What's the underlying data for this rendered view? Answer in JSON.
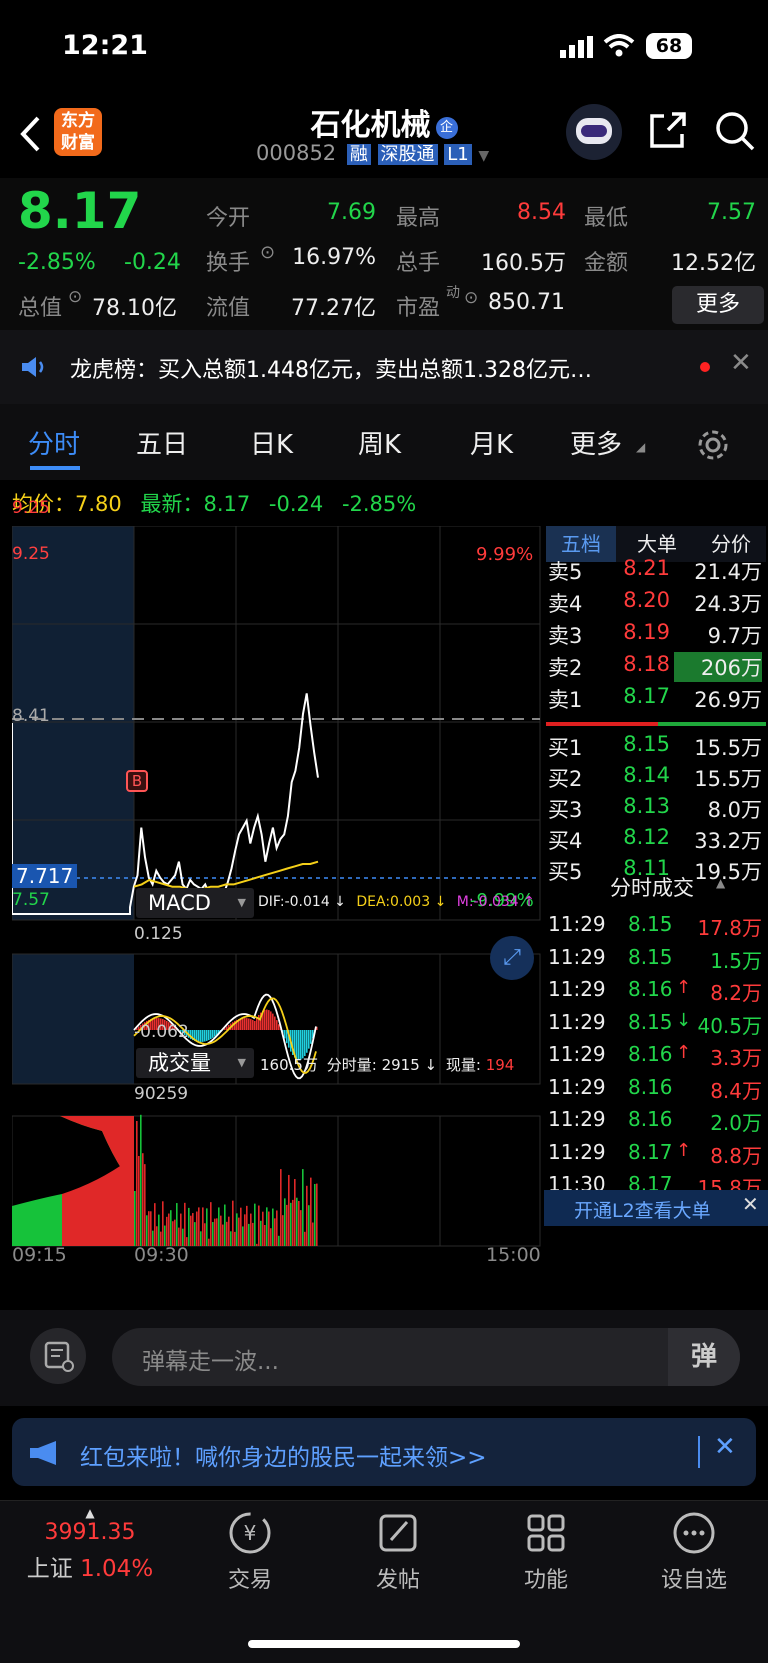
{
  "status": {
    "time": "12:21",
    "battery": "68"
  },
  "header": {
    "title": "石化机械",
    "code": "000852",
    "badge_rong": "融",
    "badge_sgt": "深股通",
    "badge_l1": "L1",
    "logo_line1": "东方",
    "logo_line2": "财富",
    "title_badge": "企"
  },
  "quote": {
    "price": "8.17",
    "change_pct": "-2.85%",
    "change": "-0.24",
    "fields": [
      {
        "label": "今开",
        "value": "7.69"
      },
      {
        "label": "最高",
        "value": "8.54"
      },
      {
        "label": "最低",
        "value": "7.57"
      },
      {
        "label": "换手",
        "value": "16.97%"
      },
      {
        "label": "总手",
        "value": "160.5万"
      },
      {
        "label": "金额",
        "value": "12.52亿"
      },
      {
        "label": "总值",
        "value": "78.10亿"
      },
      {
        "label": "流值",
        "value": "77.27亿"
      },
      {
        "label": "市盈",
        "value": "850.71",
        "sup": "动"
      }
    ],
    "more_button": "更多"
  },
  "notice": {
    "text": "龙虎榜：买入总额1.448亿元，卖出总额1.328亿元…"
  },
  "tabs": [
    "分时",
    "五日",
    "日K",
    "周K",
    "月K",
    "更多"
  ],
  "info_line": {
    "avg_label": "均价：",
    "avg": "7.80",
    "latest_label": "最新：",
    "latest": "8.17",
    "chg": "-0.24",
    "pct": "-2.85%"
  },
  "chart": {
    "y_top": "9.25",
    "y_mid": "8.41",
    "y_cross": "7.717",
    "y_bottom": "7.57",
    "pct_top": "9.99%",
    "pct_bottom": "-9.99%",
    "marker_b": "B",
    "x_start": "09:15",
    "x_open": "09:30",
    "x_end": "15:00",
    "price_series": [
      7.57,
      7.57,
      7.57,
      7.57,
      7.57,
      7.6,
      7.69,
      7.74,
      7.95,
      7.82,
      7.73,
      7.7,
      7.76,
      7.73,
      7.71,
      7.7,
      7.72,
      7.74,
      7.8,
      7.7,
      7.68,
      7.72,
      7.7,
      7.69,
      7.68,
      7.7,
      7.66,
      7.64,
      7.63,
      7.62,
      7.66,
      7.71,
      7.77,
      7.85,
      7.92,
      7.95,
      7.98,
      7.88,
      7.95,
      8.0,
      7.92,
      7.8,
      7.88,
      7.95,
      7.86,
      7.9,
      7.92,
      8.0,
      8.15,
      8.2,
      8.3,
      8.45,
      8.54,
      8.4,
      8.28,
      8.17
    ],
    "avg_series": [
      7.69,
      7.7,
      7.72,
      7.71,
      7.7,
      7.69,
      7.69,
      7.68,
      7.68,
      7.68,
      7.69,
      7.69,
      7.7,
      7.7,
      7.71,
      7.72,
      7.73,
      7.74,
      7.75,
      7.76,
      7.77,
      7.78,
      7.79,
      7.79,
      7.8
    ]
  },
  "macd": {
    "title": "MACD",
    "dif": "DIF:-0.014 ↓",
    "dea": "DEA:0.003 ↓",
    "m": "M:-0.034 ↑",
    "top": "0.125",
    "bottom": "-0.062"
  },
  "volume": {
    "title": "成交量",
    "total": "160.5万",
    "fs_label": "分时量:",
    "fs": "2915 ↓",
    "now_label": "现量:",
    "now": "194",
    "top": "90259"
  },
  "order_tabs": [
    "五档",
    "大单",
    "分价"
  ],
  "asks": [
    {
      "label": "卖5",
      "price": "8.21",
      "vol": "21.4万"
    },
    {
      "label": "卖4",
      "price": "8.20",
      "vol": "24.3万"
    },
    {
      "label": "卖3",
      "price": "8.19",
      "vol": "9.7万"
    },
    {
      "label": "卖2",
      "price": "8.18",
      "vol": "206万"
    },
    {
      "label": "卖1",
      "price": "8.17",
      "vol": "26.9万"
    }
  ],
  "bids": [
    {
      "label": "买1",
      "price": "8.15",
      "vol": "15.5万"
    },
    {
      "label": "买2",
      "price": "8.14",
      "vol": "15.5万"
    },
    {
      "label": "买3",
      "price": "8.13",
      "vol": "8.0万"
    },
    {
      "label": "买4",
      "price": "8.12",
      "vol": "33.2万"
    },
    {
      "label": "买5",
      "price": "8.11",
      "vol": "19.5万"
    }
  ],
  "ticks_title": "分时成交",
  "ticks": [
    {
      "t": "11:29",
      "p": "8.15",
      "arrow": "",
      "v": "17.8万"
    },
    {
      "t": "11:29",
      "p": "8.15",
      "arrow": "",
      "v": "1.5万"
    },
    {
      "t": "11:29",
      "p": "8.16",
      "arrow": "↑",
      "v": "8.2万"
    },
    {
      "t": "11:29",
      "p": "8.15",
      "arrow": "↓",
      "v": "40.5万"
    },
    {
      "t": "11:29",
      "p": "8.16",
      "arrow": "↑",
      "v": "3.3万"
    },
    {
      "t": "11:29",
      "p": "8.16",
      "arrow": "",
      "v": "8.4万"
    },
    {
      "t": "11:29",
      "p": "8.16",
      "arrow": "",
      "v": "2.0万"
    },
    {
      "t": "11:29",
      "p": "8.17",
      "arrow": "↑",
      "v": "8.8万"
    },
    {
      "t": "11:30",
      "p": "8.17",
      "arrow": "",
      "v": "15.8万"
    }
  ],
  "l2_banner": "开通L2查看大单",
  "comment": {
    "placeholder": "弹幕走一波...",
    "danmu_icon": "弹"
  },
  "promo": {
    "text": "红包来啦！喊你身边的股民一起来领>>"
  },
  "nav": {
    "index_value": "3991.35",
    "index_name": "上证",
    "index_pct": "1.04%",
    "items": [
      "交易",
      "发帖",
      "功能",
      "设自选"
    ]
  }
}
